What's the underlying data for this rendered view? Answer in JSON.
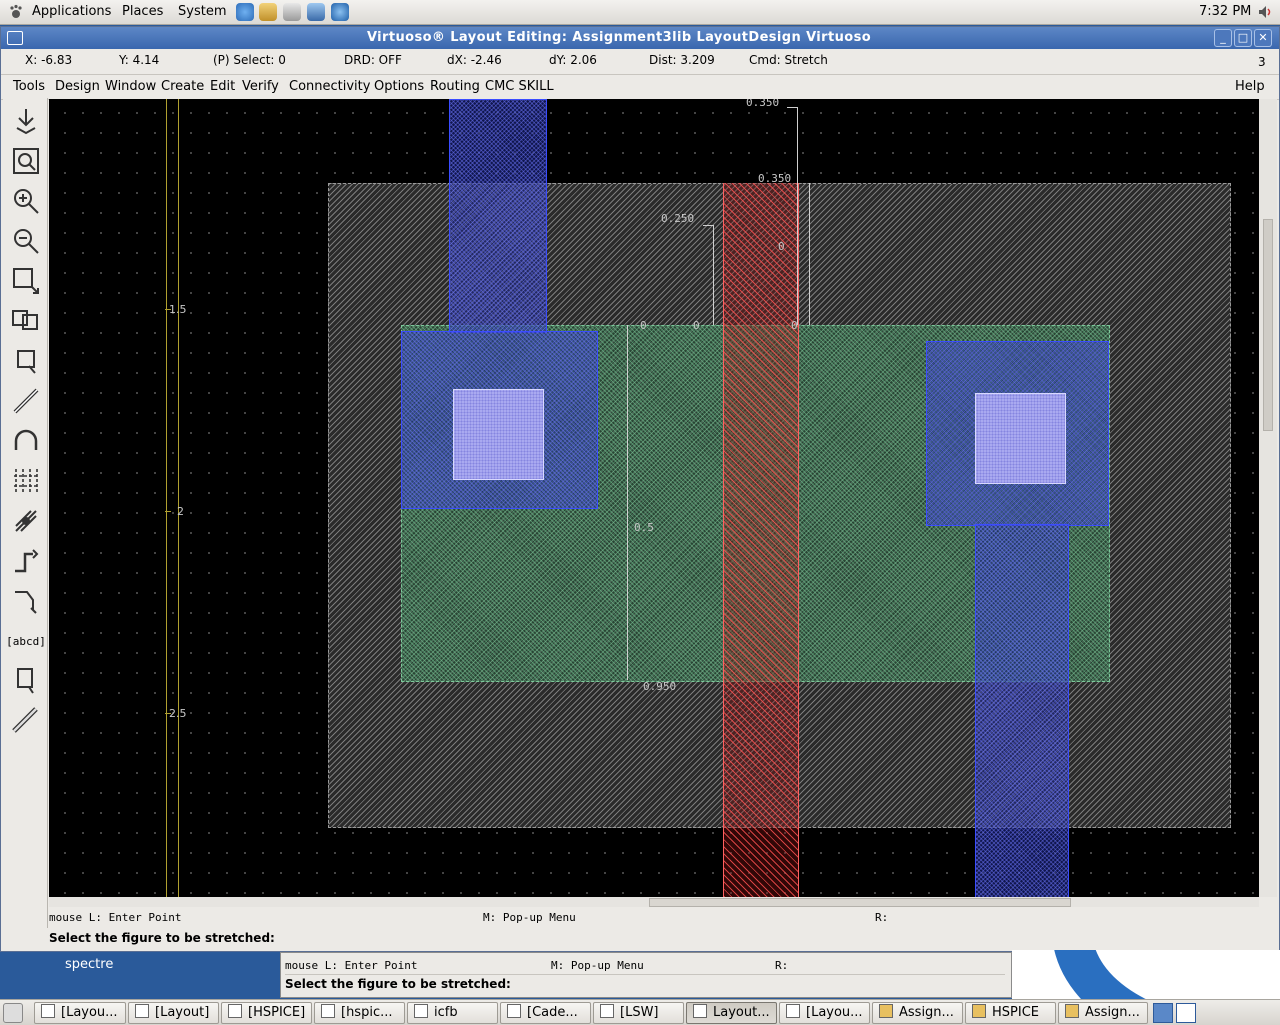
{
  "top_panel": {
    "menus": [
      "Applications",
      "Places",
      "System"
    ],
    "clock": "7:32 PM"
  },
  "window": {
    "title": "Virtuoso® Layout Editing: Assignment3lib LayoutDesign Virtuoso",
    "controls": [
      "minimize",
      "maximize",
      "close"
    ]
  },
  "status": {
    "x": "X: -6.83",
    "y": "Y: 4.14",
    "select": "(P) Select: 0",
    "drd": "DRD: OFF",
    "dx": "dX: -2.46",
    "dy": "dY: 2.06",
    "dist": "Dist: 3.209",
    "cmd": "Cmd: Stretch",
    "count": "3"
  },
  "menubar": {
    "items": [
      "Tools",
      "Design",
      "Window",
      "Create",
      "Edit",
      "Verify",
      "Connectivity",
      "Options",
      "Routing",
      "CMC SKILL"
    ],
    "help": "Help"
  },
  "toolbar": {
    "tools": [
      "save-icon",
      "fit-view-icon",
      "zoom-in-icon",
      "zoom-out-icon",
      "stretch-icon",
      "copy-icon",
      "move-icon",
      "path-icon",
      "arc-icon",
      "instance-icon",
      "via-icon",
      "wire-icon",
      "polygon-icon",
      "label-icon",
      "rectangle-icon",
      "ruler-icon"
    ],
    "label_text": "[abcd]"
  },
  "canvas": {
    "axis_labels": [
      "1.5",
      "2",
      "2.5"
    ],
    "ruler_labels": [
      "0.350",
      "0.350",
      "0.250",
      "0",
      "0",
      "0",
      "0",
      "0.5",
      "0.950"
    ]
  },
  "messages": {
    "mouse_l": "mouse L: Enter Point",
    "mouse_m": "M: Pop-up Menu",
    "mouse_r": "R:",
    "prompt": "Select the figure to be stretched:"
  },
  "ciw": {
    "mouse_l": "mouse L: Enter Point",
    "mouse_m": "M: Pop-up Menu",
    "mouse_r": "R:",
    "prompt": "Select the figure to be stretched:"
  },
  "desktop": {
    "label": "spectre"
  },
  "taskbar": {
    "tasks": [
      "[Layou...",
      "[Layout]",
      "[HSPICE]",
      "[hspic...",
      "icfb",
      "[Cade...",
      "[LSW]",
      "Layout...",
      "[Layou...",
      "Assign...",
      "HSPICE",
      "Assign..."
    ],
    "active_index": 7
  }
}
